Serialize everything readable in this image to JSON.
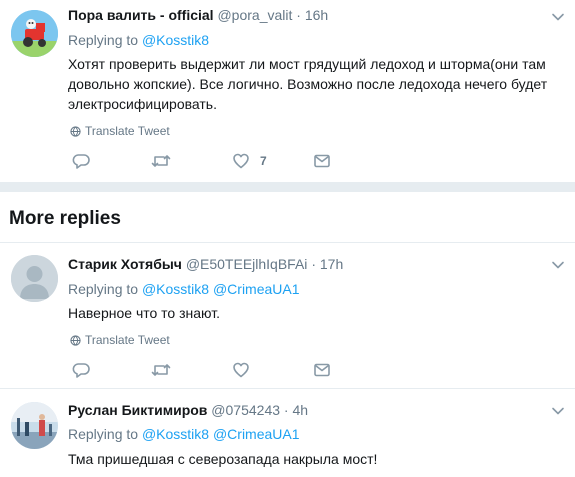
{
  "tweet_main": {
    "name": "Пора валить - official",
    "handle": "@pora_valit",
    "separator": "·",
    "time": "16h",
    "replying_prefix": "Replying to",
    "mentions": [
      "@Kosstik8"
    ],
    "text": "Хотят проверить выдержит ли мост грядущий ледоход и шторма(они там довольно жопские). Все логично. Возможно после ледохода нечего будет электросифицировать.",
    "translate_label": "Translate Tweet",
    "like_count": "7"
  },
  "more_replies": {
    "title": "More replies"
  },
  "replies": [
    {
      "name": "Старик Хотябыч",
      "handle": "@E50TEEjlhIqBFAi",
      "separator": "·",
      "time": "17h",
      "replying_prefix": "Replying to",
      "mentions": [
        "@Kosstik8",
        "@CrimeaUA1"
      ],
      "text": "Наверное что то знают.",
      "translate_label": "Translate Tweet"
    },
    {
      "name": "Руслан Биктимиров",
      "handle": "@0754243",
      "separator": "·",
      "time": "4h",
      "replying_prefix": "Replying to",
      "mentions": [
        "@Kosstik8",
        "@CrimeaUA1"
      ],
      "text": "Тма пришедшая с северозапада накрыла мост!"
    }
  ],
  "colors": {
    "accent": "#1da1f2",
    "secondary_text": "#657786",
    "separator": "#e6ecf0",
    "icon_gray": "#8899a6"
  },
  "icons": [
    "chevron-down-icon",
    "globe-icon",
    "reply-icon",
    "retweet-icon",
    "like-icon",
    "message-icon"
  ]
}
